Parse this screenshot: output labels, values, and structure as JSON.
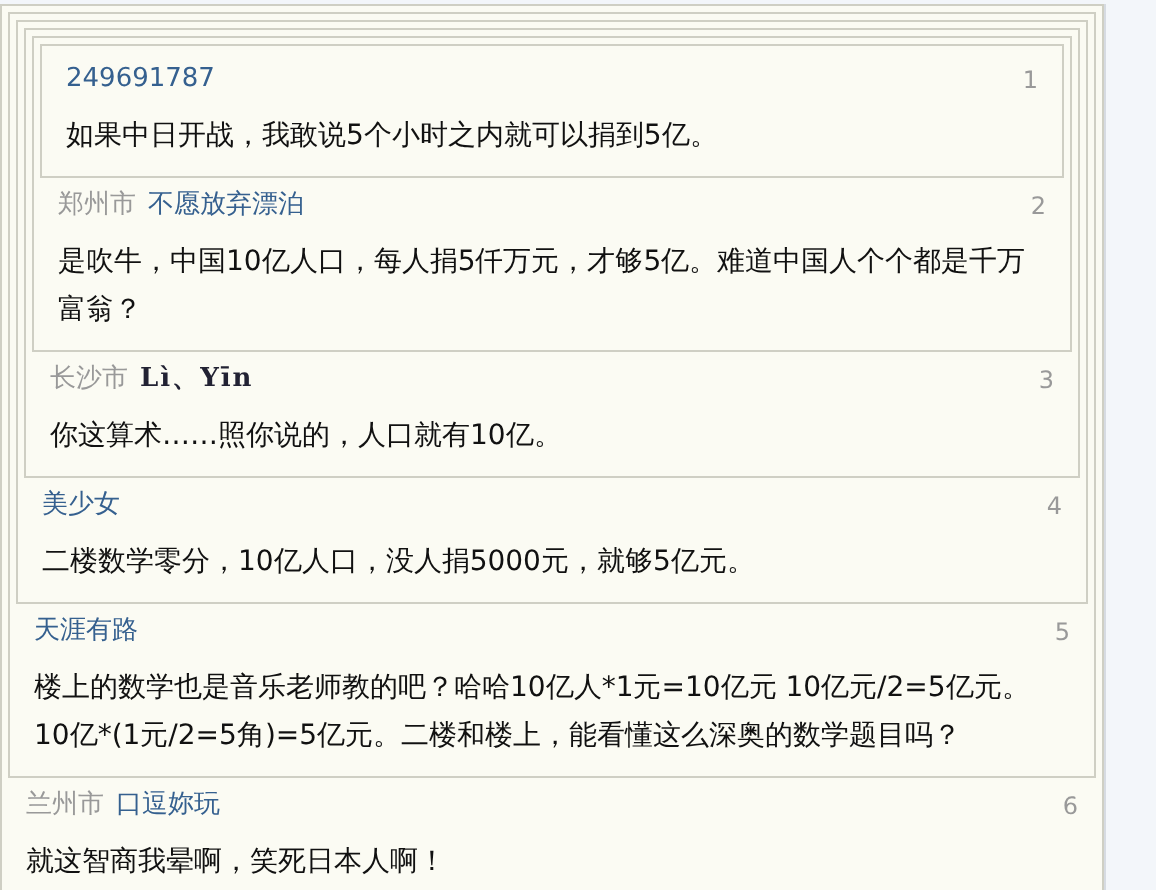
{
  "thread": {
    "location": "兰州市",
    "author": "口逗妳玩",
    "floor": "6",
    "text": "就这智商我晕啊，笑死日本人啊！",
    "quote": {
      "author": "天涯有路",
      "floor": "5",
      "text": "楼上的数学也是音乐老师教的吧？哈哈10亿人*1元=10亿元  10亿元/2=5亿元。 10亿*(1元/2=5角)=5亿元。二楼和楼上，能看懂这么深奥的数学题目吗？",
      "quote": {
        "author": "美少女",
        "floor": "4",
        "text": "二楼数学零分，10亿人口，没人捐5000元，就够5亿元。",
        "quote": {
          "location": "长沙市",
          "author": "Lì、Yīn",
          "floor": "3",
          "text": "你这算术……照你说的，人口就有10亿。",
          "quote": {
            "location": "郑州市",
            "author": "不愿放弃漂泊",
            "floor": "2",
            "text": "是吹牛，中国10亿人口，每人捐5仟万元，才够5亿。难道中国人个个都是千万富翁？",
            "quote": {
              "author": "249691787",
              "floor": "1",
              "text": "如果中日开战，我敢说5个小时之内就可以捐到5亿。"
            }
          }
        }
      }
    }
  }
}
